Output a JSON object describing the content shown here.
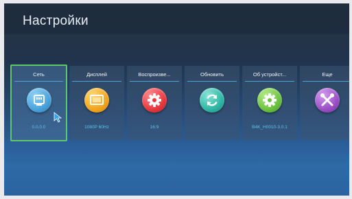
{
  "screen": {
    "title": "Настройки"
  },
  "tiles": [
    {
      "label": "Сеть",
      "value": "0.0.0.0",
      "icon": "network-icon",
      "color": "#4aa3dc",
      "selected": true
    },
    {
      "label": "Дисплей",
      "value": "1080P 60Hz",
      "icon": "display-icon",
      "color": "#f2a51c",
      "selected": false
    },
    {
      "label": "Воспроизве...",
      "value": "16:9",
      "icon": "gear-icon",
      "color": "#e8383e",
      "selected": false
    },
    {
      "label": "Обновить",
      "value": "",
      "icon": "refresh-icon",
      "color": "#2fb6a4",
      "selected": false
    },
    {
      "label": "Об устройст...",
      "value": "B4K_H0010-3.0.1",
      "icon": "gear-icon",
      "color": "#6cc23f",
      "selected": false
    },
    {
      "label": "Еще",
      "value": "",
      "icon": "tools-icon",
      "color": "#9b4fc5",
      "selected": false
    }
  ],
  "colors": {
    "accent_selected": "#5fc96a",
    "value_text": "#5fc3ee"
  }
}
